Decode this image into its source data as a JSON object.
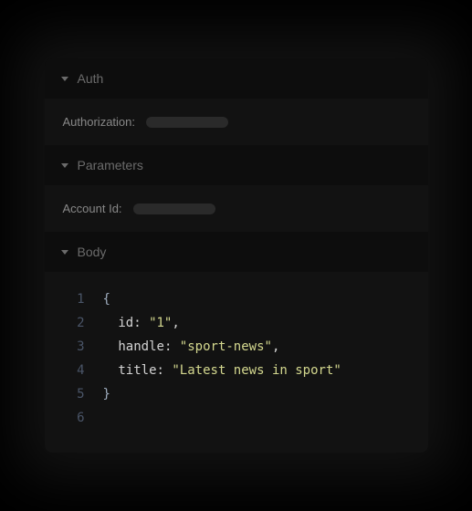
{
  "sections": {
    "auth": {
      "title": "Auth",
      "field_label": "Authorization:",
      "field_value": ""
    },
    "parameters": {
      "title": "Parameters",
      "field_label": "Account Id:",
      "field_value": ""
    },
    "body": {
      "title": "Body"
    }
  },
  "code": {
    "lines": [
      {
        "num": "1",
        "indent": "",
        "tokens": [
          {
            "t": "brace",
            "v": "{"
          }
        ]
      },
      {
        "num": "2",
        "indent": "  ",
        "tokens": [
          {
            "t": "key",
            "v": "id"
          },
          {
            "t": "punct",
            "v": ": "
          },
          {
            "t": "string",
            "v": "\"1\""
          },
          {
            "t": "punct",
            "v": ","
          }
        ]
      },
      {
        "num": "3",
        "indent": "  ",
        "tokens": [
          {
            "t": "key",
            "v": "handle"
          },
          {
            "t": "punct",
            "v": ": "
          },
          {
            "t": "string",
            "v": "\"sport-news\""
          },
          {
            "t": "punct",
            "v": ","
          }
        ]
      },
      {
        "num": "4",
        "indent": "  ",
        "tokens": [
          {
            "t": "key",
            "v": "title"
          },
          {
            "t": "punct",
            "v": ": "
          },
          {
            "t": "string",
            "v": "\"Latest news in sport\""
          }
        ]
      },
      {
        "num": "5",
        "indent": "",
        "tokens": [
          {
            "t": "brace",
            "v": "}"
          }
        ]
      },
      {
        "num": "6",
        "indent": "",
        "tokens": []
      }
    ]
  }
}
